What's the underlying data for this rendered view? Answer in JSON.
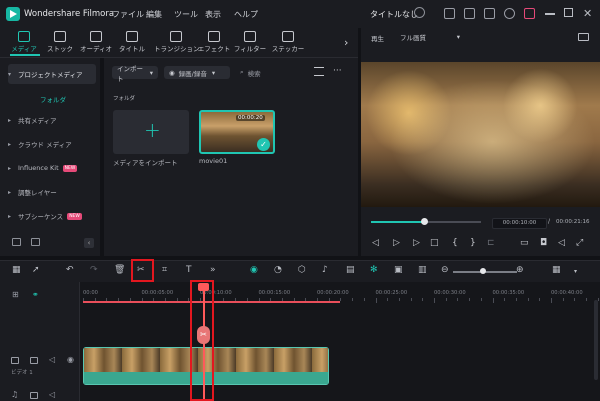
{
  "app": {
    "name": "Wondershare Filmora",
    "doc_title": "タイトルなし"
  },
  "menu": [
    "ファイル",
    "編集",
    "ツール",
    "表示",
    "ヘルプ"
  ],
  "toolbar_tabs": [
    "メディア",
    "ストック",
    "オーディオ",
    "タイトル",
    "トランジション",
    "エフェクト",
    "フィルター",
    "ステッカー"
  ],
  "sidebar": {
    "items": [
      {
        "label": "プロジェクトメディア"
      },
      {
        "label": "フォルダ"
      },
      {
        "label": "共有メディア"
      },
      {
        "label": "クラウド メディア"
      },
      {
        "label": "Influence Kit"
      },
      {
        "label": "調整レイヤー"
      },
      {
        "label": "サブシーケンス"
      }
    ],
    "new_badge": "NEW"
  },
  "media": {
    "import_dropdown": "インポート",
    "record_dropdown": "録画/録音",
    "search_placeholder": "検索",
    "folder_heading": "フォルダ",
    "import_label": "メディアをインポート",
    "clip_label": "movie01",
    "clip_duration": "00:00:20"
  },
  "player": {
    "tab": "再生",
    "quality": "フル画質",
    "time_current": "00:00:10:00",
    "time_sep": "/",
    "time_total": "00:00:21:16",
    "progress": 0.48
  },
  "timeline": {
    "ticks": [
      "00:00",
      "00:00:05:00",
      "00:00:10:00",
      "00:00:15:00",
      "00:00:20:00",
      "00:00:25:00",
      "00:00:30:00",
      "00:00:35:00",
      "00:00:40:00"
    ],
    "track_label": "ビデオ 1",
    "zoom_level": 0.47
  },
  "colors": {
    "accent": "#20c5b2",
    "highlight": "#e3171f",
    "playhead": "#ff5a5a"
  }
}
